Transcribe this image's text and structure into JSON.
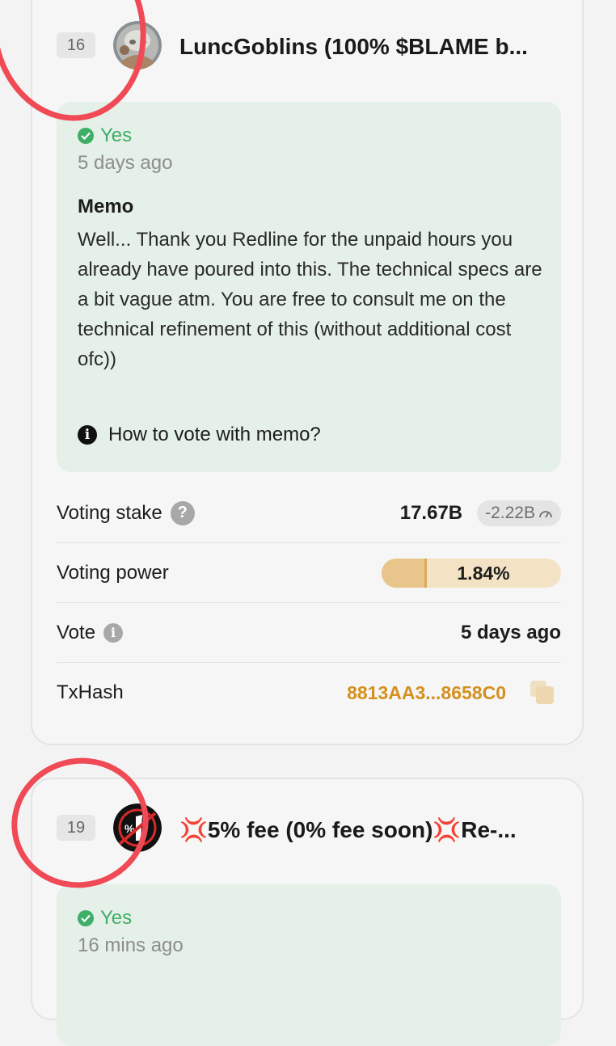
{
  "votes": [
    {
      "rank": "16",
      "validator_name": "LuncGoblins (100% $BLAME b...",
      "vote_option": "Yes",
      "vote_time": "5 days ago",
      "memo_title": "Memo",
      "memo_text": "Well... Thank you Redline for the unpaid hours you already have poured into this. The technical specs are a bit vague atm. You are free to consult me on the technical refinement of this (without additional cost ofc))",
      "howto_label": "How to vote with memo?",
      "voting_stake_label": "Voting stake",
      "voting_stake_value": "17.67B",
      "voting_stake_delta": "-2.22B",
      "voting_power_label": "Voting power",
      "voting_power_value": "1.84%",
      "voting_power_fraction": 0.24,
      "vote_label": "Vote",
      "vote_value": "5 days ago",
      "txhash_label": "TxHash",
      "txhash_value": "8813AA3...8658C0"
    },
    {
      "rank": "19",
      "validator_name": "💢5% fee (0% fee soon)💢Re-...",
      "vote_option": "Yes",
      "vote_time": "16 mins ago"
    }
  ],
  "colors": {
    "yes_green": "#3fae66",
    "accent_orange": "#d4901e",
    "memo_bg": "#e4f0e8",
    "annotation_red": "#ef4a56"
  }
}
